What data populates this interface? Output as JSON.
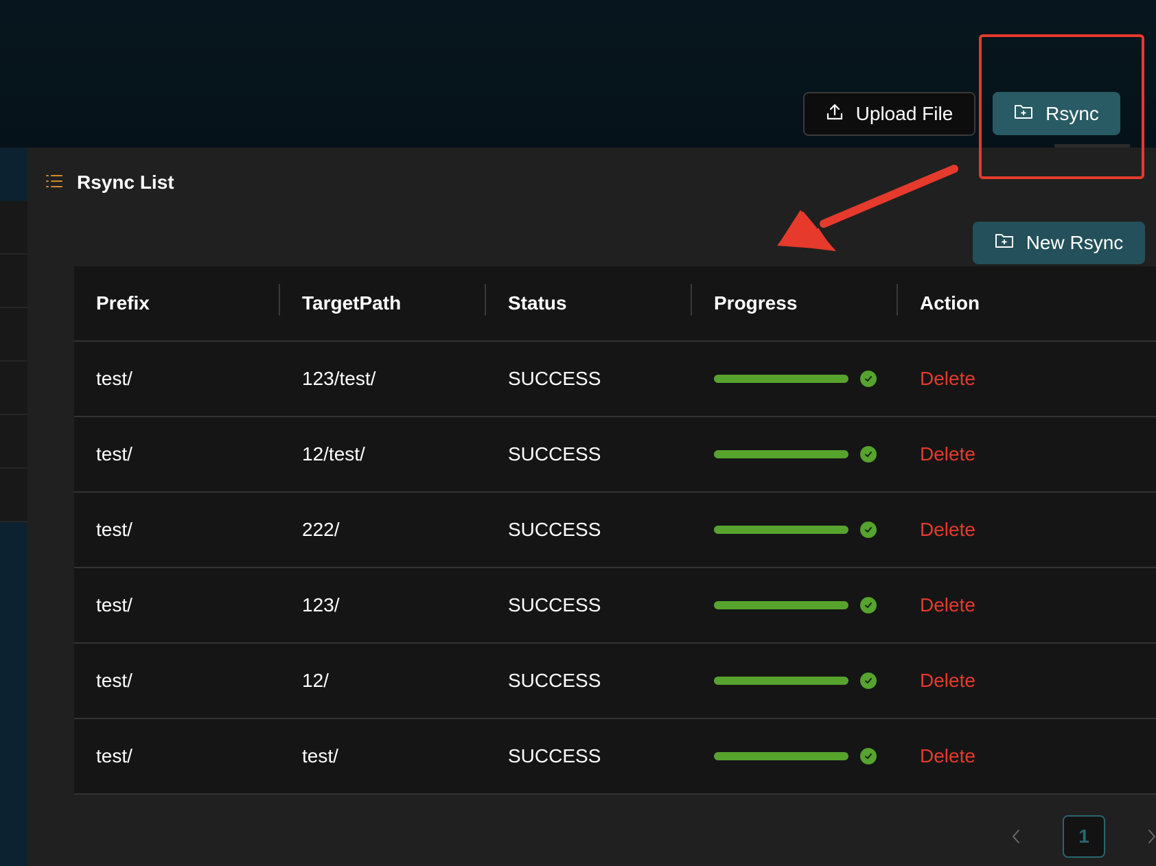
{
  "header": {
    "upload_label": "Upload File",
    "rsync_label": "Rsync",
    "upload_icon": "upload-icon",
    "rsync_icon": "folder-add-icon"
  },
  "panel": {
    "title": "Rsync List",
    "title_icon": "list-icon",
    "new_rsync_label": "New Rsync"
  },
  "table": {
    "columns": [
      "Prefix",
      "TargetPath",
      "Status",
      "Progress",
      "Action"
    ],
    "rows": [
      {
        "prefix": "test/",
        "target": "123/test/",
        "status": "SUCCESS",
        "progress": 100,
        "action": "Delete"
      },
      {
        "prefix": "test/",
        "target": "12/test/",
        "status": "SUCCESS",
        "progress": 100,
        "action": "Delete"
      },
      {
        "prefix": "test/",
        "target": "222/",
        "status": "SUCCESS",
        "progress": 100,
        "action": "Delete"
      },
      {
        "prefix": "test/",
        "target": "123/",
        "status": "SUCCESS",
        "progress": 100,
        "action": "Delete"
      },
      {
        "prefix": "test/",
        "target": "12/",
        "status": "SUCCESS",
        "progress": 100,
        "action": "Delete"
      },
      {
        "prefix": "test/",
        "target": "test/",
        "status": "SUCCESS",
        "progress": 100,
        "action": "Delete"
      }
    ]
  },
  "pagination": {
    "current": "1"
  },
  "colors": {
    "accent": "#285b63",
    "success": "#56a32e",
    "danger": "#e53a2c",
    "annotation": "#e53a2c"
  }
}
